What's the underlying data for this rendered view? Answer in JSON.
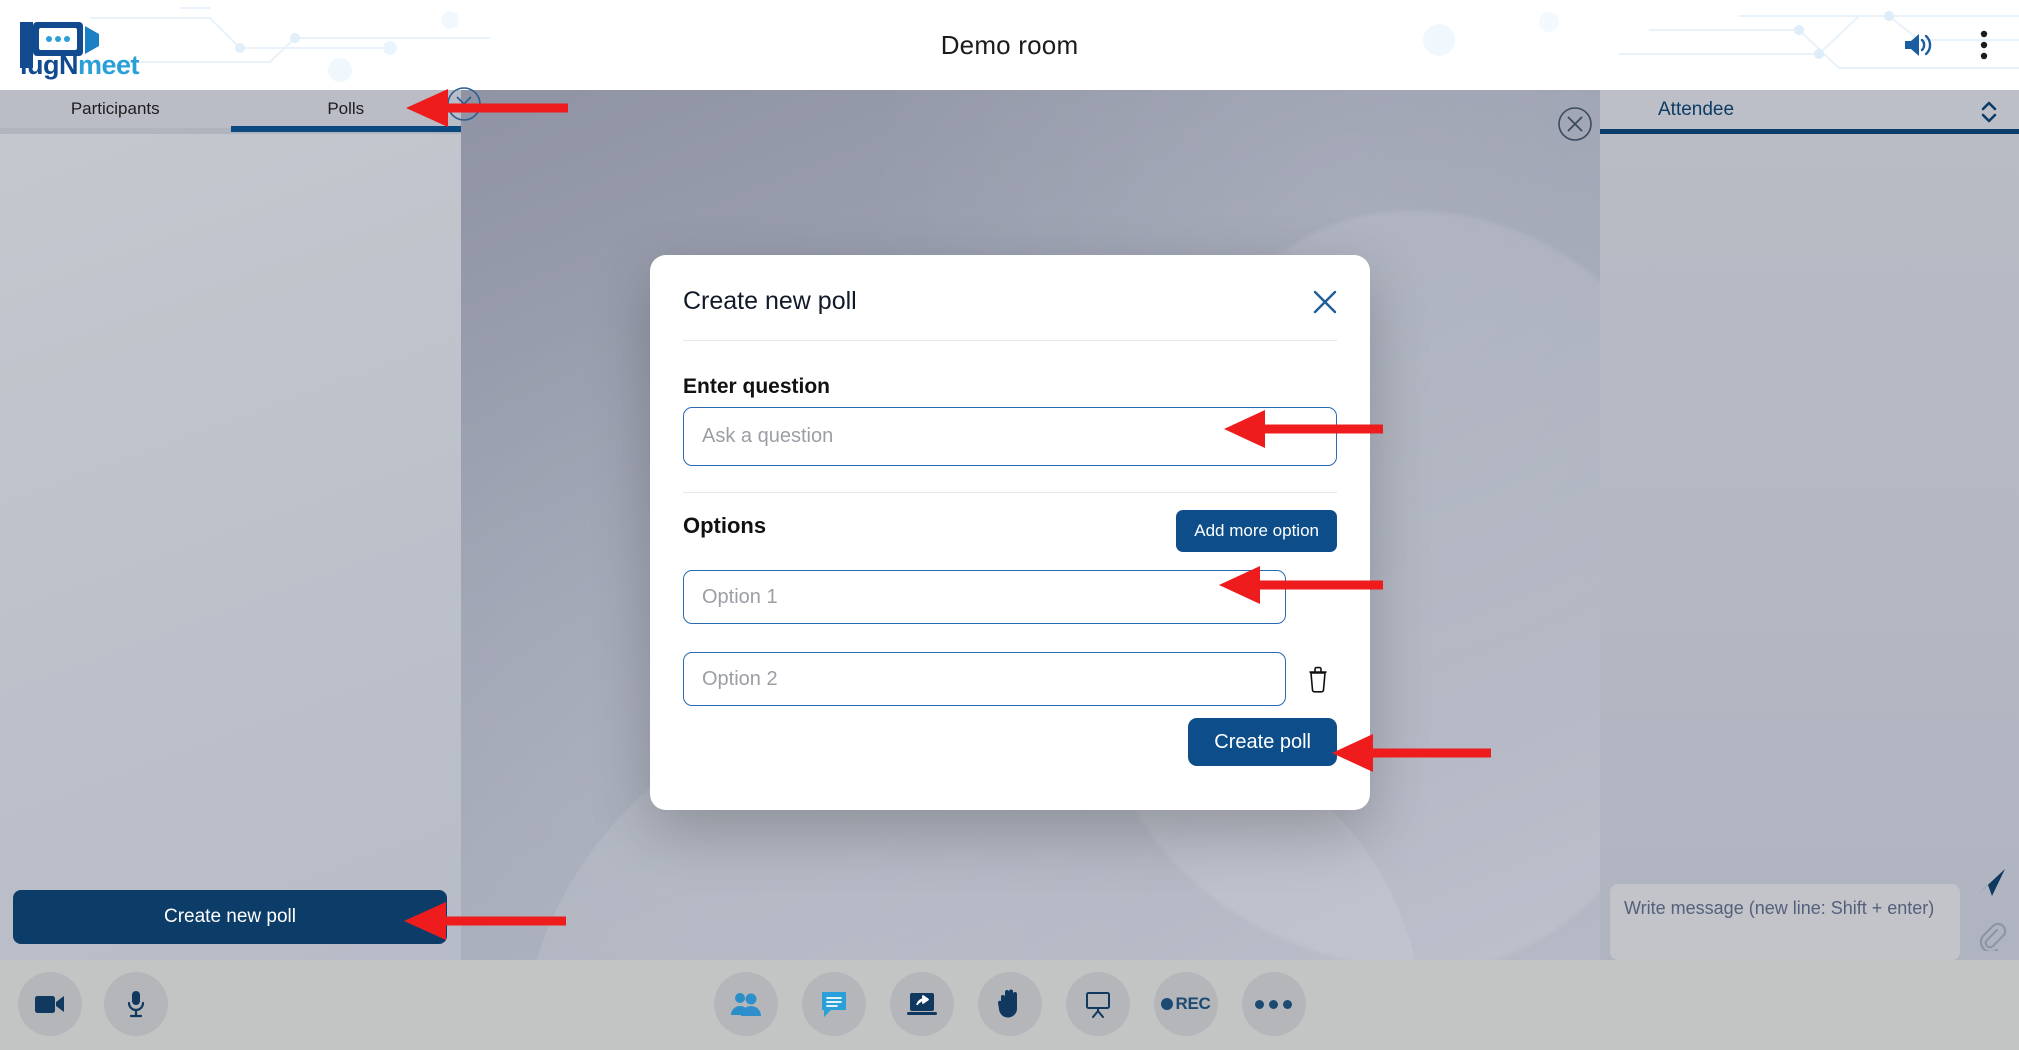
{
  "header": {
    "logo_text_1": "lug",
    "logo_text_2": "N",
    "logo_text_3": "meet",
    "room_title": "Demo room",
    "speaker_icon": "volume-up-icon",
    "menu_icon": "kebab-menu-icon"
  },
  "sidebar": {
    "tabs": [
      {
        "label": "Participants",
        "active": false
      },
      {
        "label": "Polls",
        "active": true
      }
    ],
    "create_new_poll_label": "Create new poll",
    "close_icon": "close-circle-icon"
  },
  "right_panel": {
    "title": "Attendee",
    "close_icon": "close-circle-icon",
    "sort_icon": "sort-updown-icon",
    "chat_placeholder": "Write message (new line: Shift + enter)",
    "chat_value": "",
    "send_icon": "send-icon",
    "attach_icon": "paperclip-icon"
  },
  "toolbar": {
    "left_buttons": [
      {
        "name": "webcam",
        "icon": "video-camera-icon"
      },
      {
        "name": "microphone",
        "icon": "microphone-icon"
      }
    ],
    "center_buttons": [
      {
        "name": "participants",
        "icon": "participants-icon",
        "label": ""
      },
      {
        "name": "chat",
        "icon": "chat-bubble-icon",
        "label": ""
      },
      {
        "name": "screen-share",
        "icon": "screen-share-icon",
        "label": ""
      },
      {
        "name": "raise-hand",
        "icon": "raise-hand-icon",
        "label": ""
      },
      {
        "name": "whiteboard",
        "icon": "whiteboard-icon",
        "label": ""
      },
      {
        "name": "recording",
        "icon": "record-icon",
        "label": "REC"
      },
      {
        "name": "more-options",
        "icon": "ellipsis-icon",
        "label": ""
      }
    ]
  },
  "modal": {
    "title": "Create new poll",
    "close_icon": "close-x-icon",
    "question_label": "Enter question",
    "question_placeholder": "Ask a question",
    "question_value": "",
    "options_label": "Options",
    "add_more_label": "Add more option",
    "options": [
      {
        "placeholder": "Option 1",
        "value": "",
        "deletable": false
      },
      {
        "placeholder": "Option 2",
        "value": "",
        "deletable": true
      }
    ],
    "delete_icon": "trash-icon",
    "create_poll_label": "Create poll"
  },
  "colors": {
    "brand_dark_blue": "#0c3d68",
    "brand_blue": "#0d4e8a",
    "accent_light_blue": "#2a9fd8",
    "input_border": "#2a6bb0",
    "annotation_red": "#ee1c1c",
    "panel_gray": "#b9bcc5",
    "toolbar_gray": "#c3c4c4"
  },
  "annotations": [
    {
      "name": "arrow-to-polls-tab",
      "color": "#ee1c1c"
    },
    {
      "name": "arrow-to-question-input",
      "color": "#ee1c1c"
    },
    {
      "name": "arrow-to-option1-input",
      "color": "#ee1c1c"
    },
    {
      "name": "arrow-to-create-poll-button",
      "color": "#ee1c1c"
    },
    {
      "name": "arrow-to-create-new-poll-button",
      "color": "#ee1c1c"
    }
  ]
}
